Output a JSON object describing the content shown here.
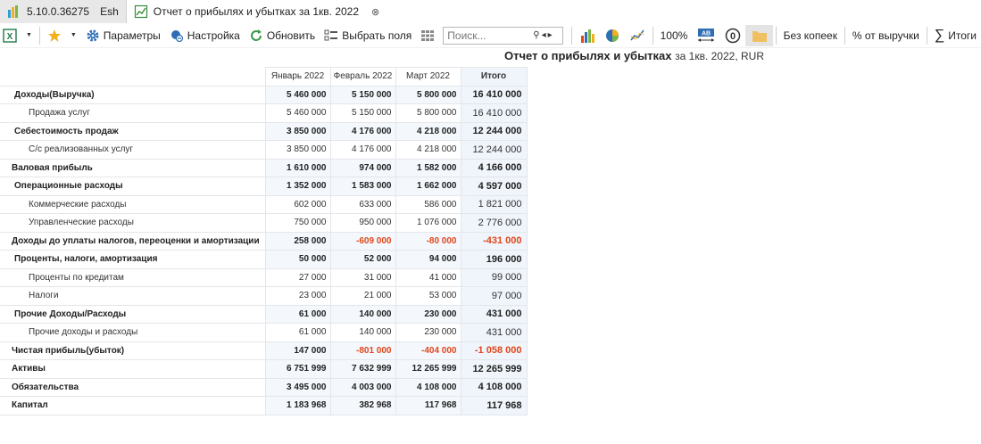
{
  "tabs": {
    "app_version": "5.10.0.36275",
    "app_user": "Esh",
    "doc_title": "Отчет о прибылях и убытках за 1кв. 2022",
    "close_glyph": "⊗"
  },
  "toolbar": {
    "params_label": "Параметры",
    "setup_label": "Настройка",
    "refresh_label": "Обновить",
    "select_fields_label": "Выбрать поля",
    "search_placeholder": "Поиск...",
    "zoom_label": "100%",
    "no_kopecks_label": "Без копеек",
    "revenue_pct_label": "% от выручки",
    "totals_label": "Итоги",
    "sigma_glyph": "∑",
    "ab_badge": "AB",
    "zero_badge": "0"
  },
  "report": {
    "title": "Отчет о прибылях и убытках",
    "subtitle": "за 1кв. 2022, RUR"
  },
  "table": {
    "columns": [
      "Январь 2022",
      "Февраль 2022",
      "Март 2022",
      "Итого"
    ],
    "rows": [
      {
        "label": "Доходы(Выручка)",
        "level": 1,
        "bold": true,
        "values": [
          "5 460 000",
          "5 150 000",
          "5 800 000",
          "16 410 000"
        ],
        "neg": [
          false,
          false,
          false,
          false
        ]
      },
      {
        "label": "Продажа услуг",
        "level": 2,
        "bold": false,
        "values": [
          "5 460 000",
          "5 150 000",
          "5 800 000",
          "16 410 000"
        ],
        "neg": [
          false,
          false,
          false,
          false
        ]
      },
      {
        "label": "Себестоимость продаж",
        "level": 1,
        "bold": true,
        "values": [
          "3 850 000",
          "4 176 000",
          "4 218 000",
          "12 244 000"
        ],
        "neg": [
          false,
          false,
          false,
          false
        ]
      },
      {
        "label": "С/с реализованных услуг",
        "level": 2,
        "bold": false,
        "values": [
          "3 850 000",
          "4 176 000",
          "4 218 000",
          "12 244 000"
        ],
        "neg": [
          false,
          false,
          false,
          false
        ]
      },
      {
        "label": "Валовая прибыль",
        "level": 0,
        "bold": true,
        "values": [
          "1 610 000",
          "974 000",
          "1 582 000",
          "4 166 000"
        ],
        "neg": [
          false,
          false,
          false,
          false
        ]
      },
      {
        "label": "Операционные расходы",
        "level": 1,
        "bold": true,
        "values": [
          "1 352 000",
          "1 583 000",
          "1 662 000",
          "4 597 000"
        ],
        "neg": [
          false,
          false,
          false,
          false
        ]
      },
      {
        "label": "Коммерческие расходы",
        "level": 2,
        "bold": false,
        "values": [
          "602 000",
          "633 000",
          "586 000",
          "1 821 000"
        ],
        "neg": [
          false,
          false,
          false,
          false
        ]
      },
      {
        "label": "Управленческие расходы",
        "level": 2,
        "bold": false,
        "values": [
          "750 000",
          "950 000",
          "1 076 000",
          "2 776 000"
        ],
        "neg": [
          false,
          false,
          false,
          false
        ]
      },
      {
        "label": "Доходы до уплаты налогов, переоценки и амортизации",
        "level": 0,
        "bold": true,
        "values": [
          "258 000",
          "-609 000",
          "-80 000",
          "-431 000"
        ],
        "neg": [
          false,
          true,
          true,
          true
        ]
      },
      {
        "label": "Проценты, налоги, амортизация",
        "level": 1,
        "bold": true,
        "values": [
          "50 000",
          "52 000",
          "94 000",
          "196 000"
        ],
        "neg": [
          false,
          false,
          false,
          false
        ]
      },
      {
        "label": "Проценты по кредитам",
        "level": 2,
        "bold": false,
        "values": [
          "27 000",
          "31 000",
          "41 000",
          "99 000"
        ],
        "neg": [
          false,
          false,
          false,
          false
        ]
      },
      {
        "label": "Налоги",
        "level": 2,
        "bold": false,
        "values": [
          "23 000",
          "21 000",
          "53 000",
          "97 000"
        ],
        "neg": [
          false,
          false,
          false,
          false
        ]
      },
      {
        "label": "Прочие Доходы/Расходы",
        "level": 1,
        "bold": true,
        "values": [
          "61 000",
          "140 000",
          "230 000",
          "431 000"
        ],
        "neg": [
          false,
          false,
          false,
          false
        ]
      },
      {
        "label": "Прочие доходы и расходы",
        "level": 2,
        "bold": false,
        "values": [
          "61 000",
          "140 000",
          "230 000",
          "431 000"
        ],
        "neg": [
          false,
          false,
          false,
          false
        ]
      },
      {
        "label": "Чистая прибыль(убыток)",
        "level": 0,
        "bold": true,
        "values": [
          "147 000",
          "-801 000",
          "-404 000",
          "-1 058 000"
        ],
        "neg": [
          false,
          true,
          true,
          true
        ]
      },
      {
        "label": "Активы",
        "level": 0,
        "bold": true,
        "values": [
          "6 751 999",
          "7 632 999",
          "12 265 999",
          "12 265 999"
        ],
        "neg": [
          false,
          false,
          false,
          false
        ]
      },
      {
        "label": "Обязательства",
        "level": 0,
        "bold": true,
        "values": [
          "3 495 000",
          "4 003 000",
          "4 108 000",
          "4 108 000"
        ],
        "neg": [
          false,
          false,
          false,
          false
        ]
      },
      {
        "label": "Капитал",
        "level": 0,
        "bold": true,
        "values": [
          "1 183 968",
          "382 968",
          "117 968",
          "117 968"
        ],
        "neg": [
          false,
          false,
          false,
          false
        ]
      }
    ]
  },
  "colors": {
    "accent_blue": "#2f6db5",
    "negative": "#e0461a",
    "excel_green": "#1e7b45",
    "star_yellow": "#f2b01e"
  }
}
